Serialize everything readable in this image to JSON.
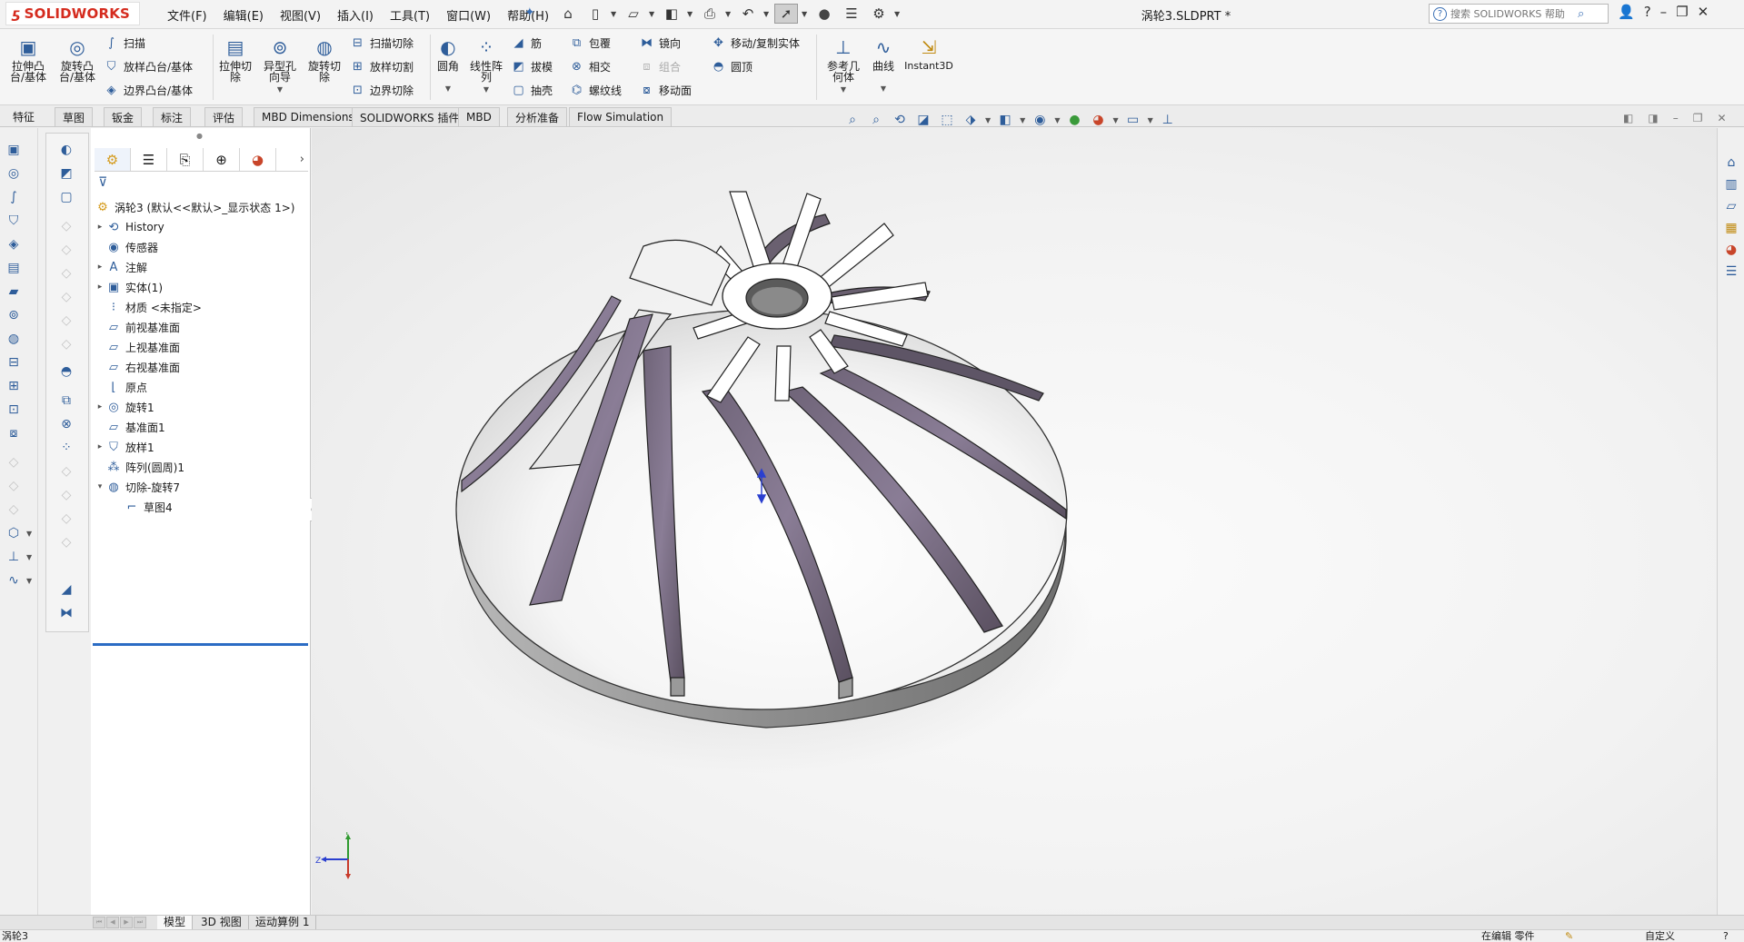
{
  "app": {
    "logo_ds": "ƽ",
    "logo_text": "SOLIDWORKS",
    "document_title": "涡轮3.SLDPRT *"
  },
  "menu": [
    "文件(F)",
    "编辑(E)",
    "视图(V)",
    "插入(I)",
    "工具(T)",
    "窗口(W)",
    "帮助(H)"
  ],
  "search": {
    "placeholder": "搜索 SOLIDWORKS 帮助"
  },
  "ribbon": {
    "extrude_boss": "拉伸凸\n台/基体",
    "revolve_boss": "旋转凸\n台/基体",
    "sweep": "扫描",
    "loft_boss": "放样凸台/基体",
    "boundary_boss": "边界凸台/基体",
    "extrude_cut": "拉伸切\n除",
    "hole_wizard": "异型孔\n向导",
    "revolve_cut": "旋转切\n除",
    "swept_cut": "扫描切除",
    "lofted_cut": "放样切割",
    "boundary_cut": "边界切除",
    "fillet": "圆角",
    "linear_pattern": "线性阵\n列",
    "rib": "筋",
    "draft": "拔模",
    "shell": "抽壳",
    "wrap": "包覆",
    "intersect": "相交",
    "helix": "螺纹线",
    "mirror": "镜向",
    "combine": "组合",
    "move_face": "移动面",
    "move_copy": "移动/复制实体",
    "dome": "圆顶",
    "ref_geometry": "参考几\n何体",
    "curves": "曲线",
    "instant3d": "Instant3D"
  },
  "tabs": [
    "特征",
    "草图",
    "钣金",
    "标注",
    "评估",
    "MBD Dimensions",
    "SOLIDWORKS 插件",
    "MBD",
    "分析准备",
    "Flow Simulation"
  ],
  "tree": {
    "root": "涡轮3  (默认<<默认>_显示状态 1>)",
    "items": [
      "History",
      "传感器",
      "注解",
      "实体(1)",
      "材质 <未指定>",
      "前视基准面",
      "上视基准面",
      "右视基准面",
      "原点",
      "旋转1",
      "基准面1",
      "放样1",
      "阵列(圆周)1",
      "切除-旋转7",
      "草图4"
    ]
  },
  "triad": {
    "x": "Z",
    "y": "Y"
  },
  "bottom_tabs": [
    "模型",
    "3D 视图",
    "运动算例 1"
  ],
  "status": {
    "left": "涡轮3",
    "mode": "在编辑 零件",
    "units": "自定义"
  },
  "colors": {
    "accent": "#2e5d9a",
    "logo_red": "#d52b1e",
    "blade_purple": "#8a7d96",
    "rollback_blue": "#2b6cc4"
  }
}
